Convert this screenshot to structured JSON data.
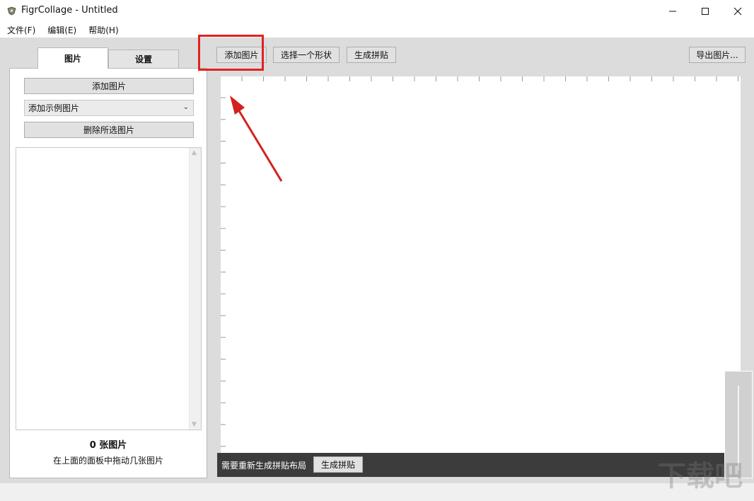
{
  "window": {
    "title": "FigrCollage - Untitled"
  },
  "menu": {
    "file": "文件(F)",
    "edit": "编辑(E)",
    "help": "帮助(H)"
  },
  "left_panel": {
    "tabs": [
      {
        "label": "图片",
        "selected": true
      },
      {
        "label": "设置",
        "selected": false
      }
    ],
    "add_button": "添加图片",
    "sample_select_value": "添加示例图片",
    "delete_button": "删除所选图片",
    "count_text": "0 张图片",
    "hint_text": "在上面的面板中拖动几张图片"
  },
  "toolbar": {
    "add_images": "添加图片",
    "choose_shape": "选择一个形状",
    "generate": "生成拼贴",
    "export": "导出图片..."
  },
  "status": {
    "message": "需要重新生成拼贴布局",
    "generate_button": "生成拼贴"
  },
  "watermark": "下载吧",
  "colors": {
    "highlight": "#e02222",
    "status_bg": "#3c3c3c",
    "panel_bg": "#dcdcdc"
  }
}
